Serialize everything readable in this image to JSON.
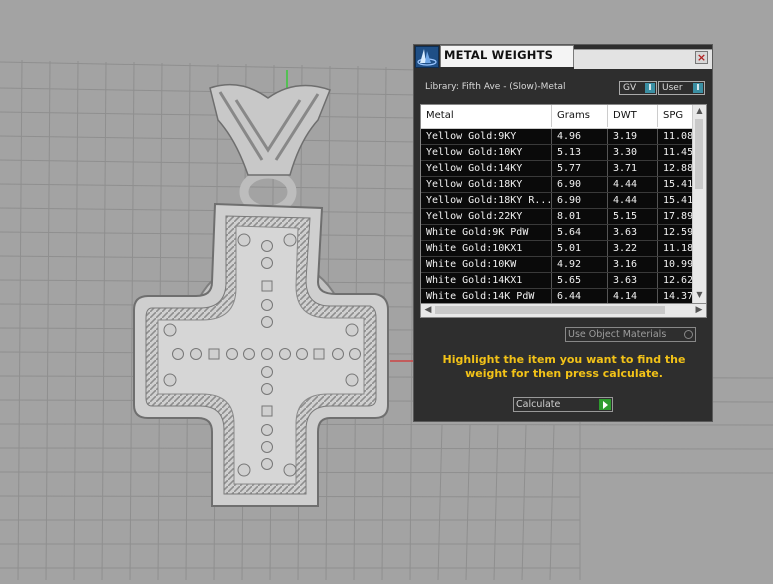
{
  "viewport": {
    "background": "#a3a3a3",
    "grid_color": "#8f8f8f",
    "axis_x_color": "#c44",
    "axis_y_color": "#3c3"
  },
  "panel": {
    "title": "METAL WEIGHTS",
    "close_label": "×",
    "library_label": "Library: Fifth Ave - (Slow)-Metal",
    "toggle_gv": "GV",
    "toggle_user": "User",
    "toggle_knob": "I",
    "columns": [
      "Metal",
      "Grams",
      "DWT",
      "SPG"
    ],
    "rows": [
      [
        "Yellow Gold:9KY",
        "4.96",
        "3.19",
        "11.08"
      ],
      [
        "Yellow Gold:10KY",
        "5.13",
        "3.30",
        "11.45"
      ],
      [
        "Yellow Gold:14KY",
        "5.77",
        "3.71",
        "12.88"
      ],
      [
        "Yellow Gold:18KY",
        "6.90",
        "4.44",
        "15.41"
      ],
      [
        "Yellow Gold:18KY R...",
        "6.90",
        "4.44",
        "15.41"
      ],
      [
        "Yellow Gold:22KY",
        "8.01",
        "5.15",
        "17.89"
      ],
      [
        "White Gold:9K PdW",
        "5.64",
        "3.63",
        "12.59"
      ],
      [
        "White Gold:10KX1",
        "5.01",
        "3.22",
        "11.18"
      ],
      [
        "White Gold:10KW",
        "4.92",
        "3.16",
        "10.99"
      ],
      [
        "White Gold:14KX1",
        "5.65",
        "3.63",
        "12.62"
      ],
      [
        "White Gold:14K PdW",
        "6.44",
        "4.14",
        "14.37"
      ]
    ],
    "use_object_materials": "Use Object Materials",
    "instructions": "Highlight the item you want to find the weight for then press calculate.",
    "calculate_label": "Calculate",
    "accent_color": "#f2c218"
  }
}
